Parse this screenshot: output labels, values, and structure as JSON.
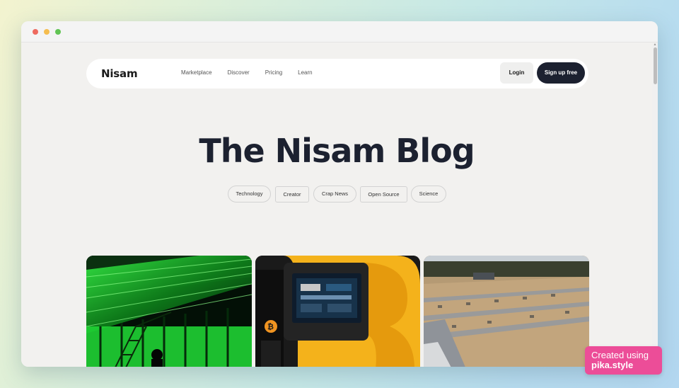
{
  "nav": {
    "logo": "Nisam",
    "links": [
      "Marketplace",
      "Discover",
      "Pricing",
      "Learn"
    ],
    "login_label": "Login",
    "signup_label": "Sign up free"
  },
  "hero": {
    "title": "The Nisam Blog"
  },
  "tags": [
    "Technology",
    "Creator",
    "Crap News",
    "Open Source",
    "Science"
  ],
  "badge": {
    "line1": "Created using",
    "line2": "pika.style"
  },
  "colors": {
    "brand_dark": "#1c2130",
    "badge_pink": "#ec4d98",
    "page_bg": "#f2f1ef"
  }
}
